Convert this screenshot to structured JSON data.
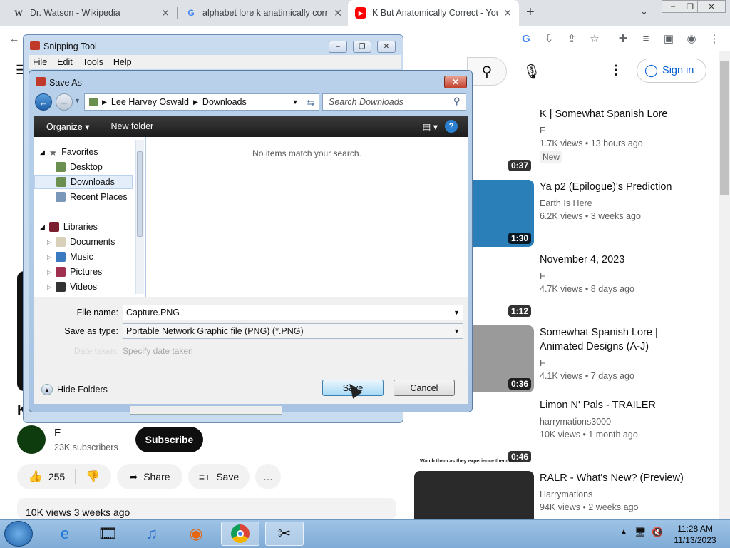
{
  "browser": {
    "tabs": [
      {
        "title": "Dr. Watson - Wikipedia",
        "favicon": "W"
      },
      {
        "title": "alphabet lore k anatimically corre",
        "favicon": "G"
      },
      {
        "title": "K But Anatomically Correct - You",
        "favicon": "▶"
      }
    ],
    "new_tab": "+"
  },
  "youtube": {
    "sign_in": "Sign in",
    "channel_name": "F",
    "subscribers": "23K subscribers",
    "subscribe": "Subscribe",
    "likes": "255",
    "share": "Share",
    "save": "Save",
    "more": "…",
    "views_date": "10K views  3 weeks ago",
    "video_title_fragment": "K",
    "sidebar": [
      {
        "title": "K | Somewhat Spanish Lore",
        "channel": "F",
        "meta": "1.7K views  • 13 hours ago",
        "badge": "New",
        "duration": "0:37",
        "color": "#ffffff"
      },
      {
        "title": "Ya p2 (Epilogue)'s Prediction",
        "channel": "Earth Is Here",
        "meta": "6.2K views  • 3 weeks ago",
        "duration": "1:30",
        "color": "#2a7fb8"
      },
      {
        "title": "November 4, 2023",
        "channel": "F",
        "meta": "4.7K views  • 8 days ago",
        "duration": "1:12",
        "color": "#ffffff"
      },
      {
        "title": "Somewhat Spanish Lore | Animated Designs (A-J)",
        "channel": "F",
        "meta": "4.1K views  • 7 days ago",
        "duration": "0:36",
        "color": "#9a9a9a"
      },
      {
        "title": "Limon N' Pals - TRAILER",
        "channel": "harrymations3000",
        "meta": "10K views  • 1 month ago",
        "duration": "0:46",
        "caption": "Watch them as they experience them lives",
        "color": "#ffffff"
      },
      {
        "title": "RALR - What's New? (Preview)",
        "channel": "Harrymations",
        "meta": "94K views  • 2 weeks ago",
        "color": "#2a2a2a"
      }
    ]
  },
  "snipping_tool": {
    "title": "Snipping Tool",
    "menu": [
      "File",
      "Edit",
      "Tools",
      "Help"
    ]
  },
  "save_as": {
    "title": "Save As",
    "breadcrumb": [
      "Lee Harvey Oswald",
      "Downloads"
    ],
    "search_placeholder": "Search Downloads",
    "organize": "Organize ▾",
    "new_folder": "New folder",
    "empty_message": "No items match your search.",
    "nav": {
      "favorites_header": "Favorites",
      "favorites": [
        "Desktop",
        "Downloads",
        "Recent Places"
      ],
      "libraries_header": "Libraries",
      "libraries": [
        "Documents",
        "Music",
        "Pictures",
        "Videos"
      ]
    },
    "file_name_label": "File name:",
    "file_name_value": "Capture.PNG",
    "save_type_label": "Save as type:",
    "save_type_value": "Portable Network Graphic file (PNG) (*.PNG)",
    "date_taken_label": "Date taken:",
    "date_taken_value": "Specify date taken",
    "hide_folders": "Hide Folders",
    "save_button": "Save",
    "cancel_button": "Cancel"
  },
  "taskbar": {
    "time": "11:28 AM",
    "date": "11/13/2023"
  }
}
